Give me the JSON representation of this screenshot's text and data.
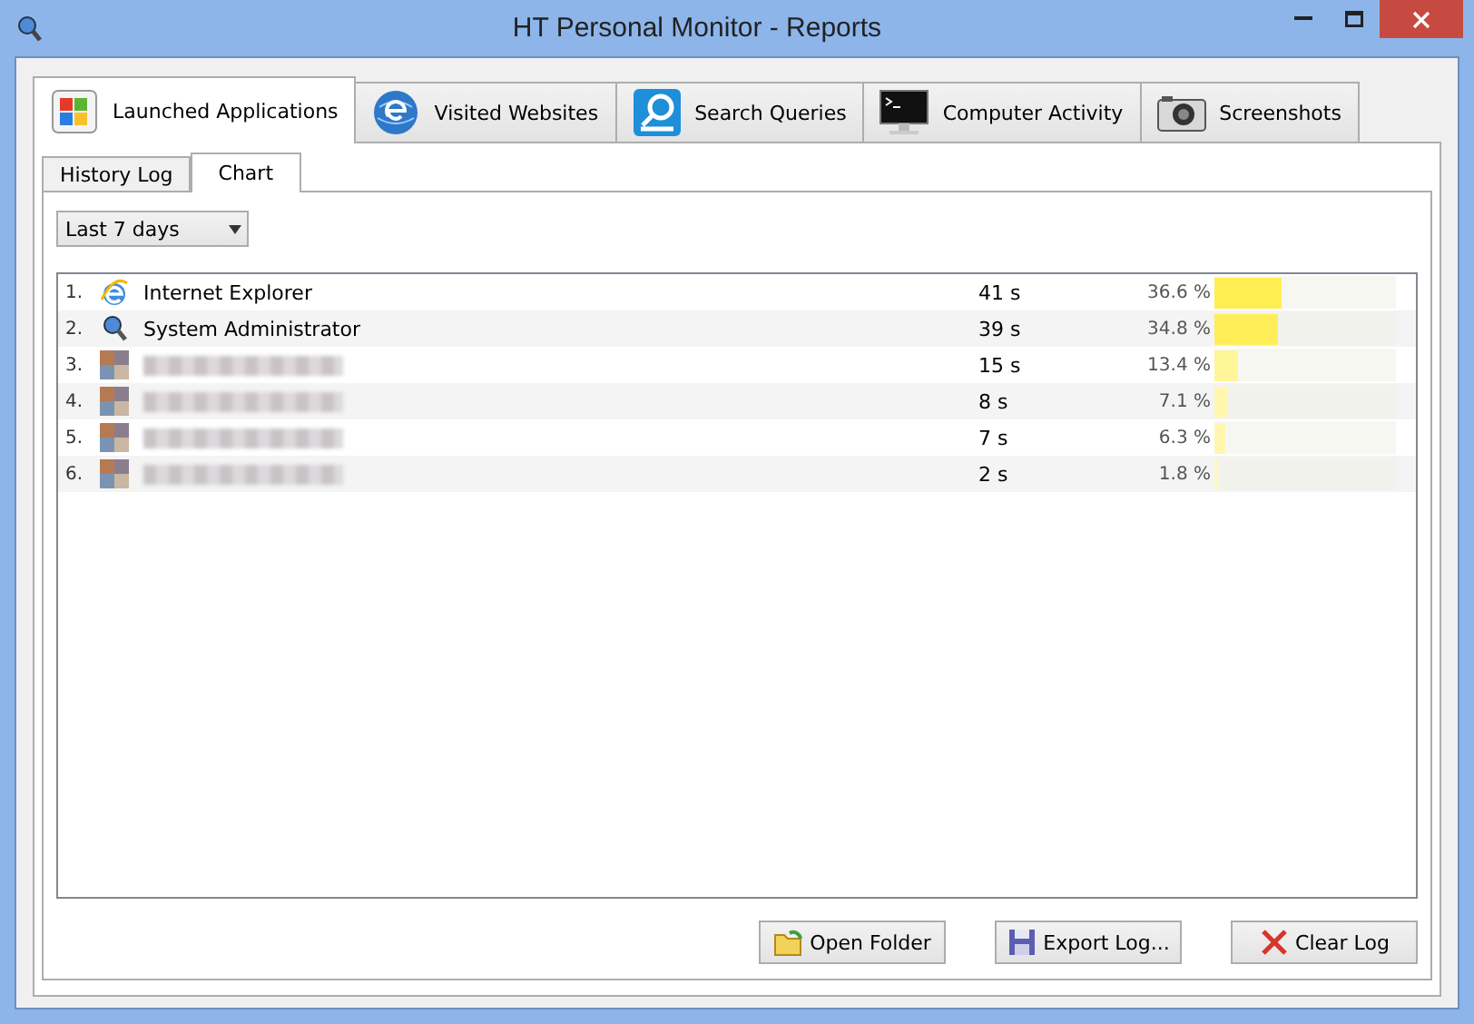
{
  "window": {
    "title": "HT Personal Monitor - Reports"
  },
  "tabs": [
    {
      "label": "Launched Applications",
      "selected": true
    },
    {
      "label": "Visited  Websites",
      "selected": false
    },
    {
      "label": "Search Queries",
      "selected": false
    },
    {
      "label": "Computer Activity",
      "selected": false
    },
    {
      "label": "Screenshots",
      "selected": false
    }
  ],
  "subtabs": [
    {
      "label": "History Log",
      "selected": false
    },
    {
      "label": "Chart",
      "selected": true
    }
  ],
  "period": {
    "value": "Last 7 days"
  },
  "rows": [
    {
      "index": "1.",
      "name": "Internet Explorer",
      "obscured": false,
      "time": "41 s",
      "percent": "36.6 %",
      "level": 0.366
    },
    {
      "index": "2.",
      "name": "System Administrator",
      "obscured": false,
      "time": "39 s",
      "percent": "34.8 %",
      "level": 0.348
    },
    {
      "index": "3.",
      "obscured": true,
      "time": "15 s",
      "percent": "13.4 %",
      "level": 0.134
    },
    {
      "index": "4.",
      "obscured": true,
      "time": "8 s",
      "percent": "7.1 %",
      "level": 0.071
    },
    {
      "index": "5.",
      "obscured": true,
      "time": "7 s",
      "percent": "6.3 %",
      "level": 0.063
    },
    {
      "index": "6.",
      "obscured": true,
      "time": "2 s",
      "percent": "1.8 %",
      "level": 0.018
    }
  ],
  "buttons": [
    {
      "label": "Open Folder"
    },
    {
      "label": "Export Log..."
    },
    {
      "label": "Clear Log"
    }
  ]
}
